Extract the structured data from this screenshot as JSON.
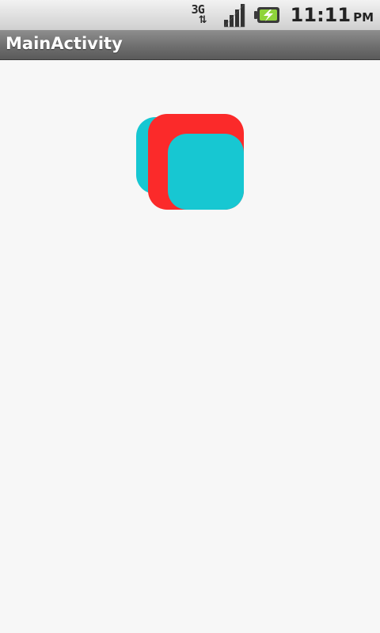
{
  "status_bar": {
    "network_type": "3G",
    "network_icon": "3g-data-icon",
    "signal_icon": "signal-strength-icon",
    "battery_icon": "battery-charging-icon",
    "time": "11:11",
    "ampm": "PM"
  },
  "app_bar": {
    "title": "MainActivity"
  },
  "content": {
    "shapes": [
      {
        "name": "rounded-square-back",
        "color": "#17c7d2"
      },
      {
        "name": "rounded-square-middle",
        "color": "#fb2a2a"
      },
      {
        "name": "rounded-square-front",
        "color": "#17c7d2"
      }
    ]
  }
}
